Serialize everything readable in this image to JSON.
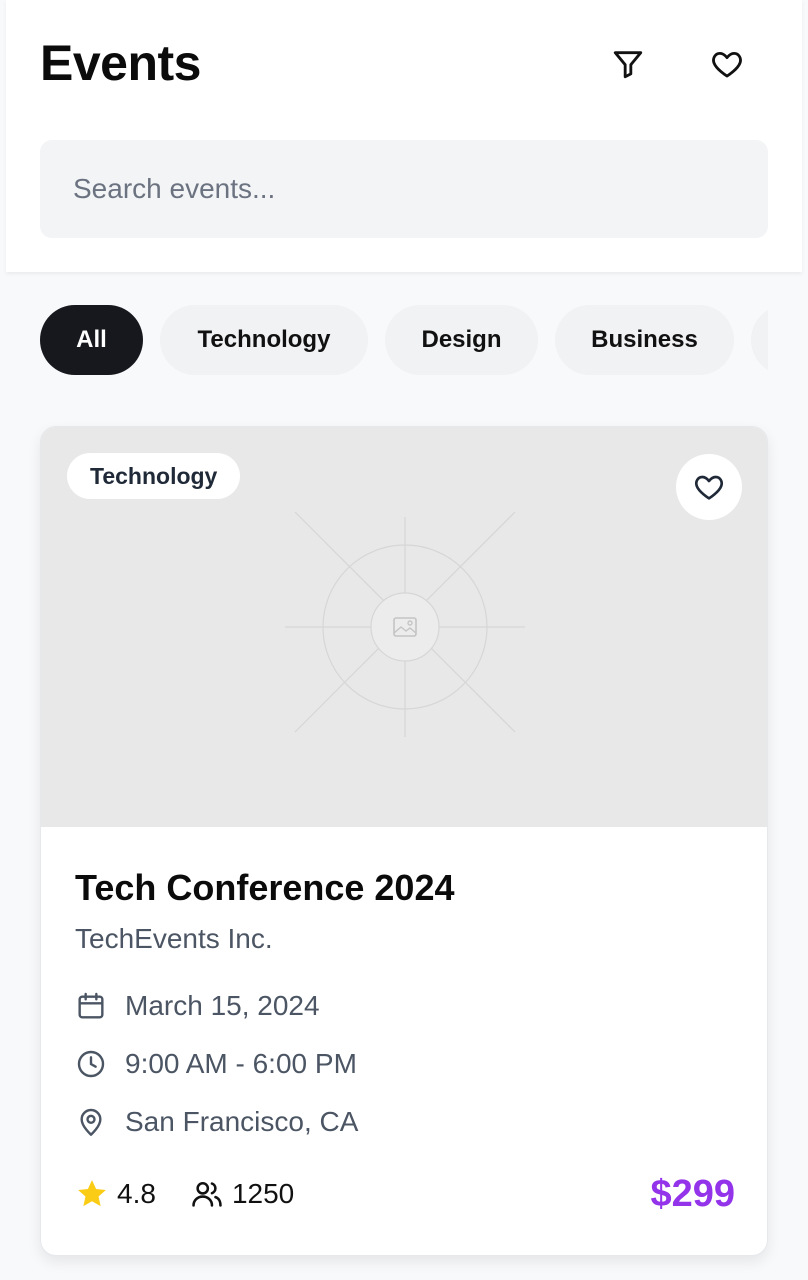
{
  "header": {
    "title": "Events",
    "search_placeholder": "Search events..."
  },
  "icons": {
    "filter": "filter-icon",
    "favorites": "heart-icon",
    "image_placeholder": "image-icon",
    "calendar": "calendar-icon",
    "clock": "clock-icon",
    "location": "map-pin-icon",
    "rating": "star-icon",
    "attendees": "users-icon"
  },
  "categories": {
    "items": [
      "All",
      "Technology",
      "Design",
      "Business",
      ""
    ],
    "selected": "All"
  },
  "event": {
    "category": "Technology",
    "title": "Tech Conference 2024",
    "organizer": "TechEvents Inc.",
    "date": "March 15, 2024",
    "time": "9:00 AM - 6:00 PM",
    "location": "San Francisco, CA",
    "rating": "4.8",
    "attendees": "1250",
    "price": "$299"
  },
  "colors": {
    "accent_price": "#9333ea",
    "chip_active_bg": "#16181d",
    "star": "#facc15",
    "meta_text": "#4b5563"
  }
}
